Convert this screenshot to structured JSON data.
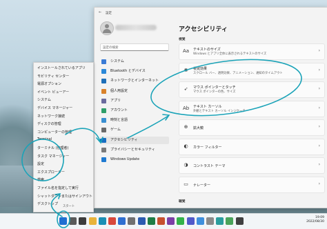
{
  "settings": {
    "title": "設定",
    "back_glyph": "←",
    "search_placeholder": "設定の検索",
    "nav": [
      {
        "label": "システム",
        "color": "#3a7bd5"
      },
      {
        "label": "Bluetooth とデバイス",
        "color": "#2b88d8"
      },
      {
        "label": "ネットワークとインターネット",
        "color": "#1f6fb8"
      },
      {
        "label": "個人用設定",
        "color": "#d9822b"
      },
      {
        "label": "アプリ",
        "color": "#6b6b9e"
      },
      {
        "label": "アカウント",
        "color": "#2f9e6a"
      },
      {
        "label": "時刻と言語",
        "color": "#3a8fd1"
      },
      {
        "label": "ゲーム",
        "color": "#6a6a6a"
      },
      {
        "label": "アクセシビリティ",
        "color": "#1a6fc2"
      },
      {
        "label": "プライバシーとセキュリティ",
        "color": "#7a7a7a"
      },
      {
        "label": "Windows Update",
        "color": "#1f7ad1"
      }
    ],
    "page_title": "アクセシビリティ",
    "section_vision": "視覚",
    "section_hearing": "聴覚",
    "cards": [
      {
        "title": "テキストのサイズ",
        "sub": "Windows とアプリ全体に表示されるテキストのサイズ",
        "icon": "text-size-icon",
        "glyph": "Aa"
      },
      {
        "title": "視覚効果",
        "sub": "スクロール バー、透明効果、アニメーション、通知のタイムアウト",
        "icon": "visual-effects-icon",
        "glyph": "✺"
      },
      {
        "title": "マウス ポインターとタッチ",
        "sub": "マウス ポインターの色、サイズ",
        "icon": "mouse-pointer-icon",
        "glyph": "➶"
      },
      {
        "title": "テキスト カーソル",
        "sub": "外観とテキスト カーソル インジケーター",
        "icon": "text-cursor-icon",
        "glyph": "Ab"
      },
      {
        "title": "拡大鏡",
        "sub": "",
        "icon": "magnifier-icon",
        "glyph": "⊕"
      },
      {
        "title": "カラー フィルター",
        "sub": "",
        "icon": "color-filter-icon",
        "glyph": "◐"
      },
      {
        "title": "コントラスト テーマ",
        "sub": "",
        "icon": "contrast-icon",
        "glyph": "◑"
      },
      {
        "title": "ナレーター",
        "sub": "",
        "icon": "narrator-icon",
        "glyph": "▭"
      }
    ]
  },
  "context_menu": {
    "items": [
      "インストールされているアプリ",
      "モビリティ センター",
      "電源オプション",
      "イベント ビューアー",
      "システム",
      "デバイス マネージャー",
      "ネットワーク接続",
      "ディスクの管理",
      "コンピューターの管理",
      "Terminal",
      "ターミナル (管理者)",
      "タスク マネージャー",
      "設定",
      "エクスプローラー",
      "検索",
      "ファイル名を指定して実行",
      "シャットダウンまたはサインアウト",
      "デスクトップ"
    ],
    "start_tooltip": "スタート"
  },
  "taskbar": {
    "time": "19:09",
    "date": "2022/08/30",
    "icons": [
      {
        "name": "start-icon",
        "color": "#1f6fd1"
      },
      {
        "name": "search-icon",
        "color": "#5a5a5a"
      },
      {
        "name": "task-view-icon",
        "color": "#3c3c3c"
      },
      {
        "name": "file-explorer-icon",
        "color": "#e8b33a"
      },
      {
        "name": "edge-icon",
        "color": "#1a8fb5"
      },
      {
        "name": "chrome-icon",
        "color": "#d8483c"
      },
      {
        "name": "store-icon",
        "color": "#2e6fd0"
      },
      {
        "name": "settings-icon",
        "color": "#707070"
      },
      {
        "name": "word-icon",
        "color": "#2b5bb0"
      },
      {
        "name": "excel-icon",
        "color": "#1e7d45"
      },
      {
        "name": "powerpoint-icon",
        "color": "#c6502f"
      },
      {
        "name": "onenote-icon",
        "color": "#7b3fa6"
      },
      {
        "name": "line-icon",
        "color": "#33b24a"
      },
      {
        "name": "teams-icon",
        "color": "#5059c9"
      },
      {
        "name": "app-icon-blue",
        "color": "#3f8fdc"
      },
      {
        "name": "app-icon-gray",
        "color": "#8a8a8a"
      },
      {
        "name": "app-icon-teal",
        "color": "#2a9d9d"
      },
      {
        "name": "app-icon-green",
        "color": "#4aa35a"
      },
      {
        "name": "app-icon-dark",
        "color": "#404040"
      }
    ]
  },
  "annotation_color": "#1aa3b8"
}
